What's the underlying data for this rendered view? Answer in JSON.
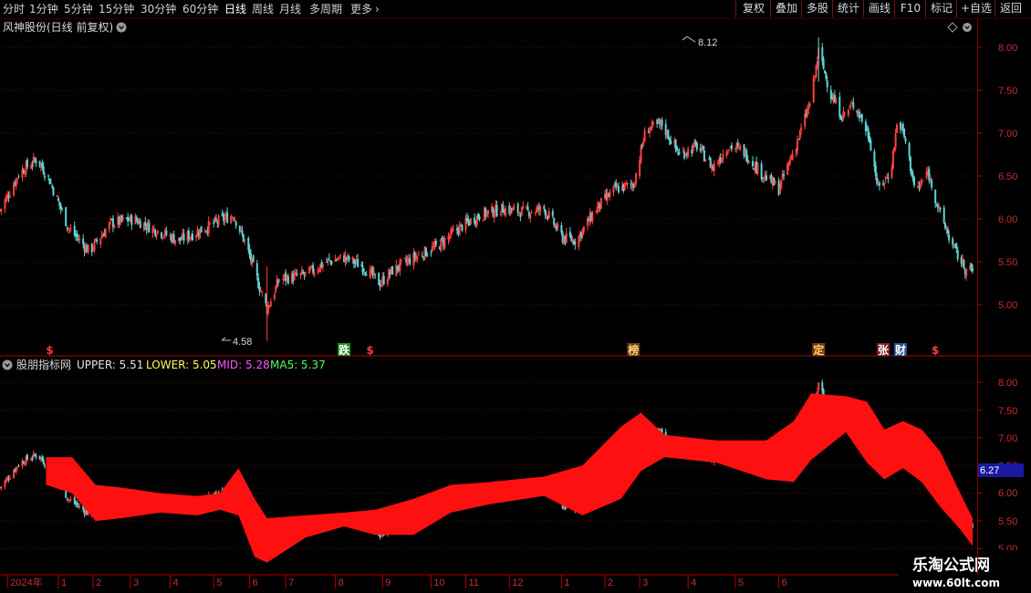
{
  "toolbar": {
    "periods": [
      "分时",
      "1分钟",
      "5分钟",
      "15分钟",
      "30分钟",
      "60分钟",
      "日线",
      "周线",
      "月线",
      "多周期",
      "更多"
    ],
    "active_period": "日线",
    "right_buttons": [
      "复权",
      "叠加",
      "多股",
      "统计",
      "画线",
      "F10",
      "标记",
      "+自选",
      "返回"
    ]
  },
  "main_panel": {
    "title": "风神股份(日线 前复权)",
    "high_label": "8.12",
    "low_label": "4.58",
    "yticks": [
      "8.00",
      "7.50",
      "7.00",
      "6.50",
      "6.00",
      "5.50",
      "5.00"
    ],
    "events": [
      {
        "date": "2023-06-13",
        "text": "$",
        "color": "#ff3b3b"
      },
      {
        "date": "2024-02-05",
        "text": "跌",
        "color": "#ffffff",
        "bg": "#1f8a1f"
      },
      {
        "date": "2024-02-26",
        "text": "$",
        "color": "#ff3b3b"
      },
      {
        "date": "2024-09-25",
        "text": "榜",
        "color": "#ffd27a",
        "bg": "#6a3a12"
      },
      {
        "date": "2025-02-21",
        "text": "定",
        "color": "#ffd27a",
        "bg": "#7a3a10"
      },
      {
        "date": "2025-04-14",
        "text": "张",
        "color": "#ffffff",
        "bg": "#7a2020"
      },
      {
        "date": "2025-04-28",
        "text": "财",
        "color": "#ffffff",
        "bg": "#1f4f8a"
      },
      {
        "date": "2025-05-26",
        "text": "$",
        "color": "#ff3b3b"
      }
    ]
  },
  "indicator_panel": {
    "name": "股朋指标网",
    "values": [
      {
        "label": "UPPER: 5.51",
        "color": "#e6e6e6"
      },
      {
        "label": "LOWER: 5.05",
        "color": "#ffff55"
      },
      {
        "label": "MID: 5.28",
        "color": "#ff55ff"
      },
      {
        "label": "MA5: 5.37",
        "color": "#55ff55"
      }
    ],
    "yticks": [
      "8.00",
      "7.50",
      "7.00",
      "6.50",
      "6.00",
      "5.50",
      "5.00"
    ],
    "current_price": "6.27"
  },
  "xaxis": {
    "labels": [
      {
        "date": "2023-05-10",
        "text": "2024年"
      },
      {
        "date": "2023-06-20",
        "text": "1"
      },
      {
        "date": "2023-07-18",
        "text": "2"
      },
      {
        "date": "2023-08-17",
        "text": "3"
      },
      {
        "date": "2023-09-18",
        "text": "4"
      },
      {
        "date": "2023-10-23",
        "text": "5"
      },
      {
        "date": "2023-11-21",
        "text": "6"
      },
      {
        "date": "2023-12-20",
        "text": "7"
      },
      {
        "date": "2024-01-29",
        "text": "8"
      },
      {
        "date": "2024-03-07",
        "text": "9"
      },
      {
        "date": "2024-04-15",
        "text": "10"
      },
      {
        "date": "2024-05-13",
        "text": "11"
      },
      {
        "date": "2024-06-17",
        "text": "12"
      },
      {
        "date": "2024-07-29",
        "text": "1"
      },
      {
        "date": "2024-09-02",
        "text": "2"
      },
      {
        "date": "2024-09-30",
        "text": "3"
      },
      {
        "date": "2024-11-08",
        "text": "4"
      },
      {
        "date": "2024-12-16",
        "text": "5"
      },
      {
        "date": "2025-01-20",
        "text": "6"
      }
    ]
  },
  "watermark": {
    "title": "乐淘公式网",
    "url": "www.60lt.com"
  },
  "colors": {
    "up": "#ff4040",
    "down": "#5fd4d4",
    "band": "#ff1010",
    "grid": "#6a0000",
    "axis": "#b00000"
  },
  "chart_data": {
    "type": "candlestick",
    "date_range": [
      "2023-05-04",
      "2025-06-25"
    ],
    "ylim": [
      4.4,
      8.3
    ],
    "indicator_ylim": [
      4.95,
      8.3
    ],
    "close_path": [
      {
        "date": "2023-05-04",
        "value": 6.1
      },
      {
        "date": "2023-05-20",
        "value": 6.55
      },
      {
        "date": "2023-06-03",
        "value": 6.7
      },
      {
        "date": "2023-06-13",
        "value": 6.45
      },
      {
        "date": "2023-06-28",
        "value": 5.9
      },
      {
        "date": "2023-07-15",
        "value": 5.62
      },
      {
        "date": "2023-08-01",
        "value": 5.95
      },
      {
        "date": "2023-08-20",
        "value": 6.0
      },
      {
        "date": "2023-09-05",
        "value": 5.88
      },
      {
        "date": "2023-09-25",
        "value": 5.75
      },
      {
        "date": "2023-10-10",
        "value": 5.85
      },
      {
        "date": "2023-10-28",
        "value": 5.98
      },
      {
        "date": "2023-11-08",
        "value": 6.05
      },
      {
        "date": "2023-11-18",
        "value": 5.7
      },
      {
        "date": "2023-11-28",
        "value": 5.25
      },
      {
        "date": "2023-12-05",
        "value": 4.95
      },
      {
        "date": "2023-12-15",
        "value": 5.3
      },
      {
        "date": "2024-01-05",
        "value": 5.35
      },
      {
        "date": "2024-01-22",
        "value": 5.5
      },
      {
        "date": "2024-02-05",
        "value": 5.55
      },
      {
        "date": "2024-02-20",
        "value": 5.45
      },
      {
        "date": "2024-03-05",
        "value": 5.25
      },
      {
        "date": "2024-03-15",
        "value": 5.4
      },
      {
        "date": "2024-04-01",
        "value": 5.55
      },
      {
        "date": "2024-04-20",
        "value": 5.68
      },
      {
        "date": "2024-05-08",
        "value": 5.9
      },
      {
        "date": "2024-05-25",
        "value": 6.05
      },
      {
        "date": "2024-06-12",
        "value": 6.12
      },
      {
        "date": "2024-06-30",
        "value": 6.08
      },
      {
        "date": "2024-07-15",
        "value": 6.12
      },
      {
        "date": "2024-07-30",
        "value": 5.78
      },
      {
        "date": "2024-08-10",
        "value": 5.75
      },
      {
        "date": "2024-08-25",
        "value": 6.1
      },
      {
        "date": "2024-09-10",
        "value": 6.35
      },
      {
        "date": "2024-09-25",
        "value": 6.4
      },
      {
        "date": "2024-10-05",
        "value": 7.05
      },
      {
        "date": "2024-10-18",
        "value": 7.1
      },
      {
        "date": "2024-11-01",
        "value": 6.75
      },
      {
        "date": "2024-11-15",
        "value": 6.85
      },
      {
        "date": "2024-11-28",
        "value": 6.6
      },
      {
        "date": "2024-12-10",
        "value": 6.85
      },
      {
        "date": "2024-12-22",
        "value": 6.8
      },
      {
        "date": "2025-01-05",
        "value": 6.55
      },
      {
        "date": "2025-01-20",
        "value": 6.35
      },
      {
        "date": "2025-02-05",
        "value": 6.95
      },
      {
        "date": "2025-02-15",
        "value": 7.4
      },
      {
        "date": "2025-02-21",
        "value": 7.95
      },
      {
        "date": "2025-03-03",
        "value": 7.45
      },
      {
        "date": "2025-03-12",
        "value": 7.2
      },
      {
        "date": "2025-03-22",
        "value": 7.35
      },
      {
        "date": "2025-04-03",
        "value": 6.95
      },
      {
        "date": "2025-04-10",
        "value": 6.35
      },
      {
        "date": "2025-04-20",
        "value": 6.55
      },
      {
        "date": "2025-04-26",
        "value": 7.2
      },
      {
        "date": "2025-05-03",
        "value": 6.85
      },
      {
        "date": "2025-05-10",
        "value": 6.3
      },
      {
        "date": "2025-05-20",
        "value": 6.55
      },
      {
        "date": "2025-05-30",
        "value": 6.05
      },
      {
        "date": "2025-06-10",
        "value": 5.65
      },
      {
        "date": "2025-06-20",
        "value": 5.4
      },
      {
        "date": "2025-06-25",
        "value": 5.4
      }
    ],
    "band": {
      "upper": [
        {
          "date": "2023-06-10",
          "value": 6.65
        },
        {
          "date": "2023-07-01",
          "value": 6.65
        },
        {
          "date": "2023-07-20",
          "value": 6.15
        },
        {
          "date": "2023-08-10",
          "value": 6.1
        },
        {
          "date": "2023-09-10",
          "value": 6.0
        },
        {
          "date": "2023-10-10",
          "value": 5.95
        },
        {
          "date": "2023-10-28",
          "value": 6.0
        },
        {
          "date": "2023-11-12",
          "value": 6.45
        },
        {
          "date": "2023-11-25",
          "value": 5.9
        },
        {
          "date": "2023-12-05",
          "value": 5.55
        },
        {
          "date": "2024-01-05",
          "value": 5.6
        },
        {
          "date": "2024-02-05",
          "value": 5.65
        },
        {
          "date": "2024-03-01",
          "value": 5.7
        },
        {
          "date": "2024-04-01",
          "value": 5.9
        },
        {
          "date": "2024-05-01",
          "value": 6.15
        },
        {
          "date": "2024-06-01",
          "value": 6.2
        },
        {
          "date": "2024-07-15",
          "value": 6.3
        },
        {
          "date": "2024-08-15",
          "value": 6.5
        },
        {
          "date": "2024-09-15",
          "value": 7.2
        },
        {
          "date": "2024-10-01",
          "value": 7.45
        },
        {
          "date": "2024-10-20",
          "value": 7.05
        },
        {
          "date": "2024-12-01",
          "value": 6.95
        },
        {
          "date": "2025-01-10",
          "value": 6.95
        },
        {
          "date": "2025-02-01",
          "value": 7.3
        },
        {
          "date": "2025-02-15",
          "value": 7.8
        },
        {
          "date": "2025-03-15",
          "value": 7.75
        },
        {
          "date": "2025-04-01",
          "value": 7.65
        },
        {
          "date": "2025-04-15",
          "value": 7.15
        },
        {
          "date": "2025-04-30",
          "value": 7.3
        },
        {
          "date": "2025-05-15",
          "value": 7.15
        },
        {
          "date": "2025-05-30",
          "value": 6.75
        },
        {
          "date": "2025-06-15",
          "value": 6.0
        },
        {
          "date": "2025-06-25",
          "value": 5.55
        }
      ],
      "lower": [
        {
          "date": "2023-06-10",
          "value": 6.15
        },
        {
          "date": "2023-07-01",
          "value": 6.0
        },
        {
          "date": "2023-07-20",
          "value": 5.5
        },
        {
          "date": "2023-08-10",
          "value": 5.55
        },
        {
          "date": "2023-09-10",
          "value": 5.65
        },
        {
          "date": "2023-10-10",
          "value": 5.6
        },
        {
          "date": "2023-10-28",
          "value": 5.7
        },
        {
          "date": "2023-11-12",
          "value": 5.6
        },
        {
          "date": "2023-11-25",
          "value": 4.85
        },
        {
          "date": "2023-12-05",
          "value": 4.75
        },
        {
          "date": "2024-01-05",
          "value": 5.2
        },
        {
          "date": "2024-02-05",
          "value": 5.4
        },
        {
          "date": "2024-03-01",
          "value": 5.25
        },
        {
          "date": "2024-04-01",
          "value": 5.25
        },
        {
          "date": "2024-05-01",
          "value": 5.65
        },
        {
          "date": "2024-06-01",
          "value": 5.8
        },
        {
          "date": "2024-07-15",
          "value": 5.95
        },
        {
          "date": "2024-08-15",
          "value": 5.6
        },
        {
          "date": "2024-09-15",
          "value": 5.9
        },
        {
          "date": "2024-10-01",
          "value": 6.4
        },
        {
          "date": "2024-10-20",
          "value": 6.65
        },
        {
          "date": "2024-12-01",
          "value": 6.55
        },
        {
          "date": "2025-01-10",
          "value": 6.25
        },
        {
          "date": "2025-02-01",
          "value": 6.2
        },
        {
          "date": "2025-02-15",
          "value": 6.6
        },
        {
          "date": "2025-03-15",
          "value": 7.1
        },
        {
          "date": "2025-04-01",
          "value": 6.55
        },
        {
          "date": "2025-04-15",
          "value": 6.25
        },
        {
          "date": "2025-04-30",
          "value": 6.45
        },
        {
          "date": "2025-05-15",
          "value": 6.2
        },
        {
          "date": "2025-05-30",
          "value": 5.75
        },
        {
          "date": "2025-06-15",
          "value": 5.35
        },
        {
          "date": "2025-06-25",
          "value": 5.05
        }
      ]
    }
  }
}
